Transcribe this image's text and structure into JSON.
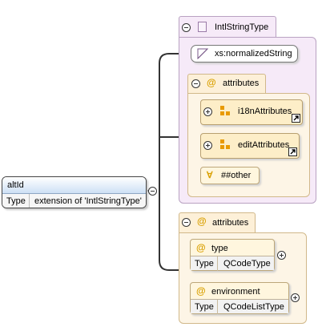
{
  "element": {
    "name": "altId",
    "type_key": "Type",
    "type_value": "extension of 'IntlStringType'"
  },
  "complex_type": {
    "name": "IntlStringType"
  },
  "simple_type": {
    "name": "xs:normalizedString"
  },
  "inner_attributes": {
    "title": "attributes",
    "groups": [
      "i18nAttributes",
      "editAttributes"
    ],
    "any_attribute": "##other"
  },
  "outer_attributes": {
    "title": "attributes",
    "items": [
      {
        "name": "type",
        "type_key": "Type",
        "type_value": "QCodeType"
      },
      {
        "name": "environment",
        "type_key": "Type",
        "type_value": "QCodeListType"
      }
    ]
  },
  "icons": {
    "attribute": "@",
    "any_attribute": "∀"
  }
}
